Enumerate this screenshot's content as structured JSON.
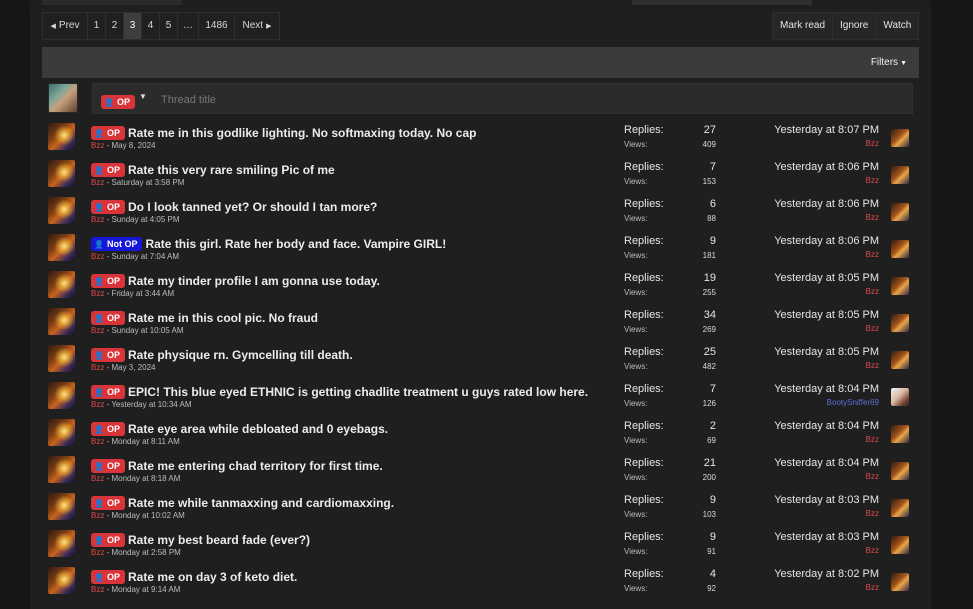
{
  "pagination": {
    "prev_label": "Prev",
    "pages": [
      "1",
      "2",
      "3",
      "4",
      "5",
      "…",
      "1486"
    ],
    "active_page": "3",
    "next_label": "Next"
  },
  "actions": {
    "mark_read": "Mark read",
    "ignore": "Ignore",
    "watch": "Watch"
  },
  "filters": {
    "label": "Filters"
  },
  "new_thread": {
    "prefix": "OP",
    "placeholder": "Thread title"
  },
  "labels": {
    "replies": "Replies:",
    "views": "Views:"
  },
  "colors": {
    "op_badge": "#d9343a",
    "not_op_badge": "#1616d8",
    "author_red": "#e04b4b",
    "author_blue": "#5b6fd6"
  },
  "threads": [
    {
      "prefix": "OP",
      "title": "Rate me in this godlike lighting. No softmaxing today. No cap",
      "author": "Bzz",
      "date": "May 8, 2024",
      "replies": "27",
      "views": "409",
      "last_time": "Yesterday at 8:07 PM",
      "last_user": "Bzz"
    },
    {
      "prefix": "OP",
      "title": "Rate this very rare smiling Pic of me",
      "author": "Bzz",
      "date": "Saturday at 3:58 PM",
      "replies": "7",
      "views": "153",
      "last_time": "Yesterday at 8:06 PM",
      "last_user": "Bzz"
    },
    {
      "prefix": "OP",
      "title": "Do I look tanned yet? Or should I tan more?",
      "author": "Bzz",
      "date": "Sunday at 4:05 PM",
      "replies": "6",
      "views": "88",
      "last_time": "Yesterday at 8:06 PM",
      "last_user": "Bzz"
    },
    {
      "prefix": "Not OP",
      "title": "Rate this girl. Rate her body and face. Vampire GIRL!",
      "author": "Bzz",
      "date": "Sunday at 7:04 AM",
      "replies": "9",
      "views": "181",
      "last_time": "Yesterday at 8:06 PM",
      "last_user": "Bzz"
    },
    {
      "prefix": "OP",
      "title": "Rate my tinder profile I am gonna use today.",
      "author": "Bzz",
      "date": "Friday at 3:44 AM",
      "replies": "19",
      "views": "255",
      "last_time": "Yesterday at 8:05 PM",
      "last_user": "Bzz"
    },
    {
      "prefix": "OP",
      "title": "Rate me in this cool pic. No fraud",
      "author": "Bzz",
      "date": "Sunday at 10:05 AM",
      "replies": "34",
      "views": "269",
      "last_time": "Yesterday at 8:05 PM",
      "last_user": "Bzz"
    },
    {
      "prefix": "OP",
      "title": "Rate physique rn. Gymcelling till death.",
      "author": "Bzz",
      "date": "May 3, 2024",
      "replies": "25",
      "views": "482",
      "last_time": "Yesterday at 8:05 PM",
      "last_user": "Bzz"
    },
    {
      "prefix": "OP",
      "title": "EPIC! This blue eyed ETHNIC is getting chadlite treatment u guys rated low here.",
      "author": "Bzz",
      "date": "Yesterday at 10:34 AM",
      "replies": "7",
      "views": "126",
      "last_time": "Yesterday at 8:04 PM",
      "last_user": "BootySniffer69"
    },
    {
      "prefix": "OP",
      "title": "Rate eye area while debloated and 0 eyebags.",
      "author": "Bzz",
      "date": "Monday at 8:11 AM",
      "replies": "2",
      "views": "69",
      "last_time": "Yesterday at 8:04 PM",
      "last_user": "Bzz"
    },
    {
      "prefix": "OP",
      "title": "Rate me entering chad territory for first time.",
      "author": "Bzz",
      "date": "Monday at 8:18 AM",
      "replies": "21",
      "views": "200",
      "last_time": "Yesterday at 8:04 PM",
      "last_user": "Bzz"
    },
    {
      "prefix": "OP",
      "title": "Rate me while tanmaxxing and cardiomaxxing.",
      "author": "Bzz",
      "date": "Monday at 10:02 AM",
      "replies": "9",
      "views": "103",
      "last_time": "Yesterday at 8:03 PM",
      "last_user": "Bzz"
    },
    {
      "prefix": "OP",
      "title": "Rate my best beard fade (ever?)",
      "author": "Bzz",
      "date": "Monday at 2:58 PM",
      "replies": "9",
      "views": "91",
      "last_time": "Yesterday at 8:03 PM",
      "last_user": "Bzz"
    },
    {
      "prefix": "OP",
      "title": "Rate me on day 3 of keto diet.",
      "author": "Bzz",
      "date": "Monday at 9:14 AM",
      "replies": "4",
      "views": "92",
      "last_time": "Yesterday at 8:02 PM",
      "last_user": "Bzz"
    }
  ]
}
